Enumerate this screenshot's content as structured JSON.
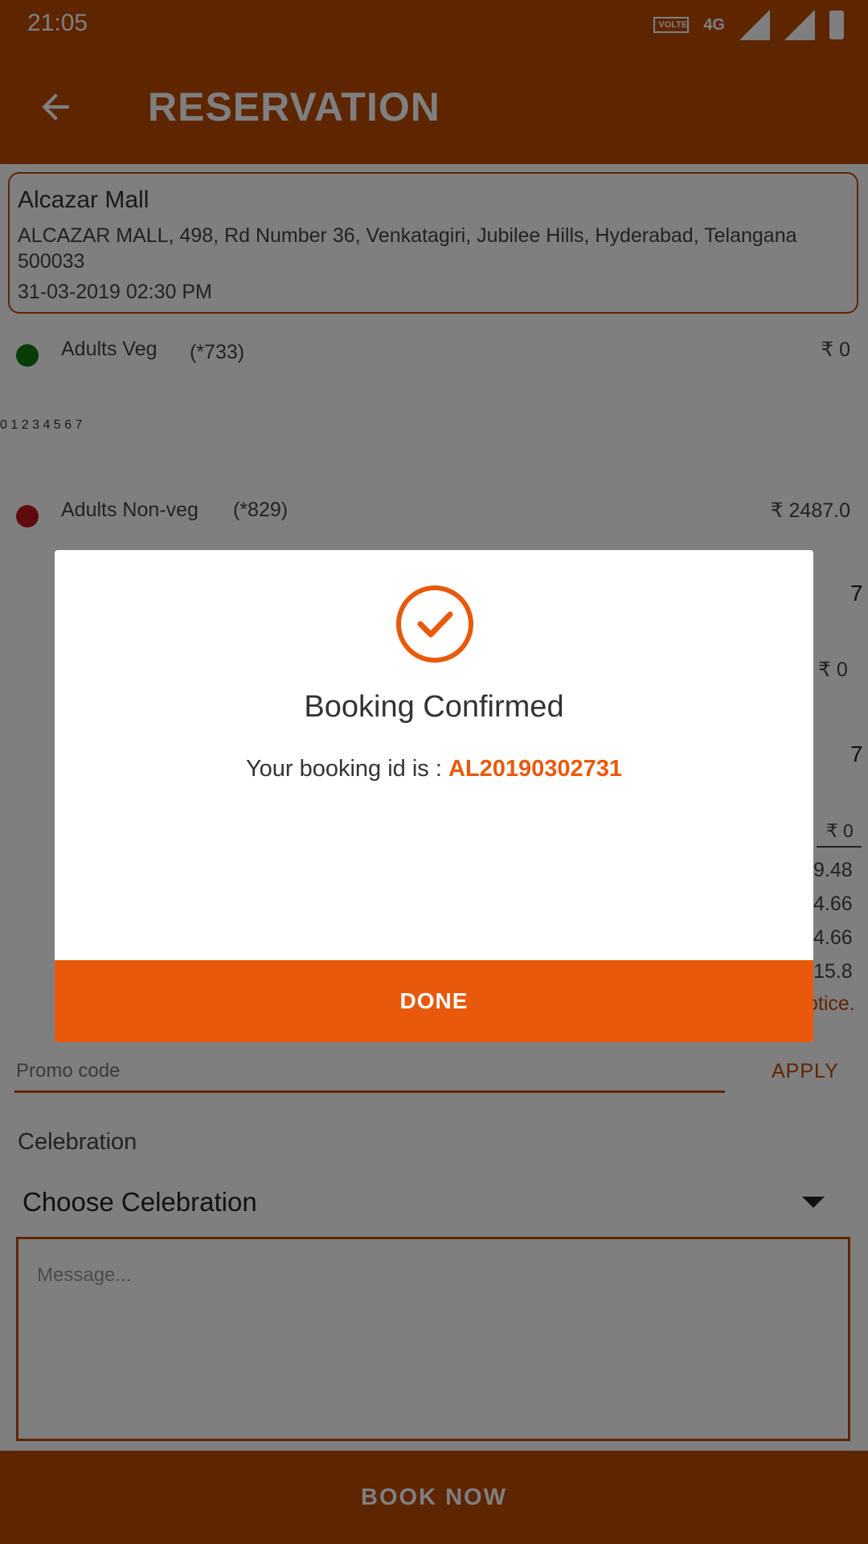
{
  "status_bar": {
    "time": "21:05",
    "volte": "VOLTE",
    "network": "4G"
  },
  "app_bar": {
    "title": "RESERVATION",
    "back_icon": "arrow-left-icon"
  },
  "venue": {
    "name": "Alcazar Mall",
    "address": "ALCAZAR MALL, 498, Rd Number 36, Venkatagiri, Jubilee Hills, Hyderabad, Telangana 500033",
    "datetime": "31-03-2019  02:30 PM"
  },
  "guests": [
    {
      "label": "Adults Veg",
      "code": "(*733)",
      "price": "₹ 0",
      "dot_color": "#0a7a0a"
    },
    {
      "label": "Adults Non-veg",
      "code": "(*829)",
      "price": "₹ 2487.0",
      "dot_color": "#c0151b"
    }
  ],
  "counter_values": [
    "0",
    "1",
    "2",
    "3",
    "4",
    "5",
    "6",
    "7"
  ],
  "partial_right_values": [
    "7",
    "₹ 0",
    "7",
    "₹ 0",
    "9.48",
    "4.66",
    "4.66",
    "15.8",
    "otice."
  ],
  "promo": {
    "placeholder": "Promo code",
    "apply_label": "APPLY"
  },
  "celebration": {
    "label": "Celebration",
    "selected": "Choose Celebration"
  },
  "message": {
    "placeholder": "Message..."
  },
  "book_now_label": "BOOK NOW",
  "dialog": {
    "icon": "check-circle-icon",
    "title": "Booking Confirmed",
    "subtitle_prefix": "Your booking id is : ",
    "booking_id": "AL20190302731",
    "done_label": "DONE"
  },
  "colors": {
    "primary": "#bd4a03",
    "accent": "#e8590b"
  }
}
